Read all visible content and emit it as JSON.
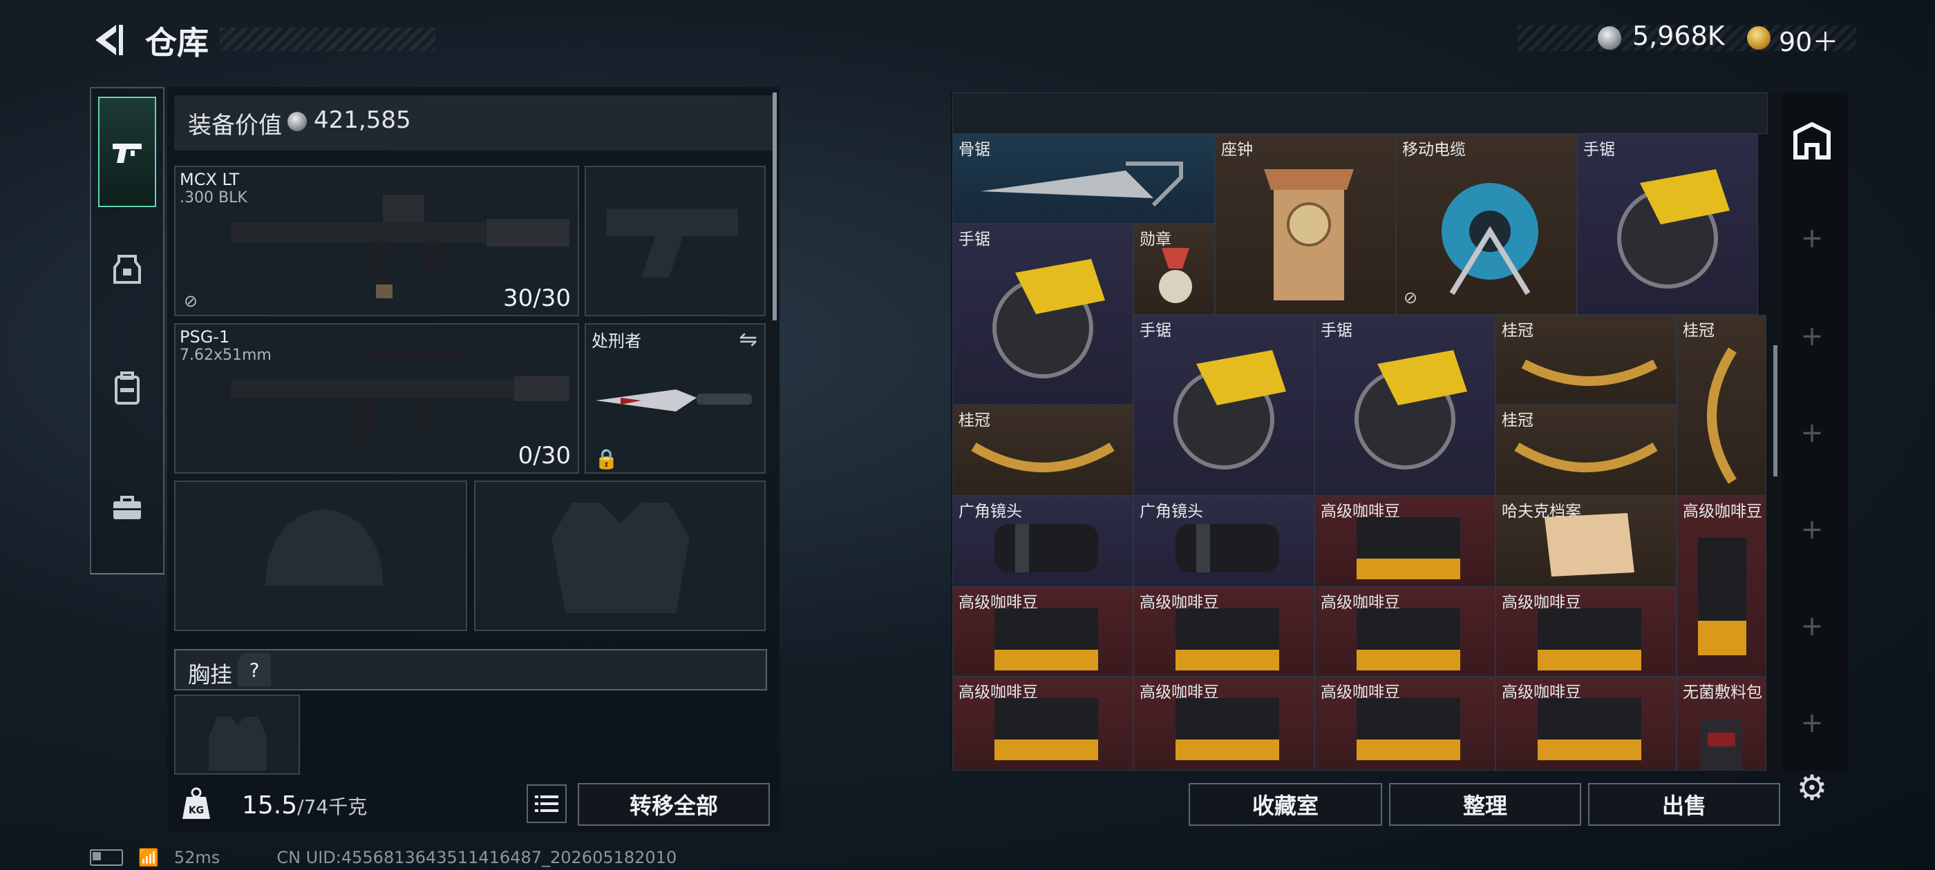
{
  "header": {
    "title": "仓库"
  },
  "currency": {
    "primary": "5,968K",
    "secondary": "90＋"
  },
  "equipment": {
    "value_label": "装备价值",
    "value": "421,585",
    "primary_weapon": {
      "name": "MCX LT",
      "caliber": ".300 BLK",
      "ammo": "30/30"
    },
    "secondary_weapon": {
      "name": "PSG-1",
      "caliber": "7.62x51mm",
      "ammo": "0/30"
    },
    "melee": {
      "name": "处刑者"
    },
    "chest_rig_label": "胸挂",
    "chest_help": "?"
  },
  "weight": {
    "current": "15.5",
    "max": "/74千克",
    "unit_icon": "KG"
  },
  "buttons": {
    "transfer_all": "转移全部",
    "vault": "收藏室",
    "sort": "整理",
    "sell": "出售"
  },
  "status": {
    "ping": "52ms",
    "uid": "CN UID:4556813643511416487_202605182010"
  },
  "storage": {
    "items": [
      {
        "label": "骨锯",
        "color": "blue"
      },
      {
        "label": "座钟",
        "color": "brown"
      },
      {
        "label": "移动电缆",
        "color": "brown"
      },
      {
        "label": "手锯",
        "color": "purple"
      },
      {
        "label": "手锯",
        "color": "purple"
      },
      {
        "label": "勋章",
        "color": "brown"
      },
      {
        "label": "手锯",
        "color": "purple"
      },
      {
        "label": "手锯",
        "color": "purple"
      },
      {
        "label": "桂冠",
        "color": "brown"
      },
      {
        "label": "桂冠",
        "color": "brown"
      },
      {
        "label": "桂冠",
        "color": "brown"
      },
      {
        "label": "桂冠",
        "color": "brown"
      },
      {
        "label": "广角镜头",
        "color": "purple"
      },
      {
        "label": "广角镜头",
        "color": "purple"
      },
      {
        "label": "高级咖啡豆",
        "color": "red"
      },
      {
        "label": "哈夫克档案",
        "color": "brown"
      },
      {
        "label": "高级咖啡豆",
        "color": "red"
      },
      {
        "label": "高级咖啡豆",
        "color": "red"
      },
      {
        "label": "高级咖啡豆",
        "color": "red"
      },
      {
        "label": "高级咖啡豆",
        "color": "red"
      },
      {
        "label": "高级咖啡豆",
        "color": "red"
      },
      {
        "label": "高级咖啡豆",
        "color": "red"
      },
      {
        "label": "高级咖啡豆",
        "color": "red"
      },
      {
        "label": "高级咖啡豆",
        "color": "red"
      },
      {
        "label": "高级咖啡豆",
        "color": "red"
      },
      {
        "label": "无菌敷料包",
        "color": "red"
      }
    ]
  }
}
